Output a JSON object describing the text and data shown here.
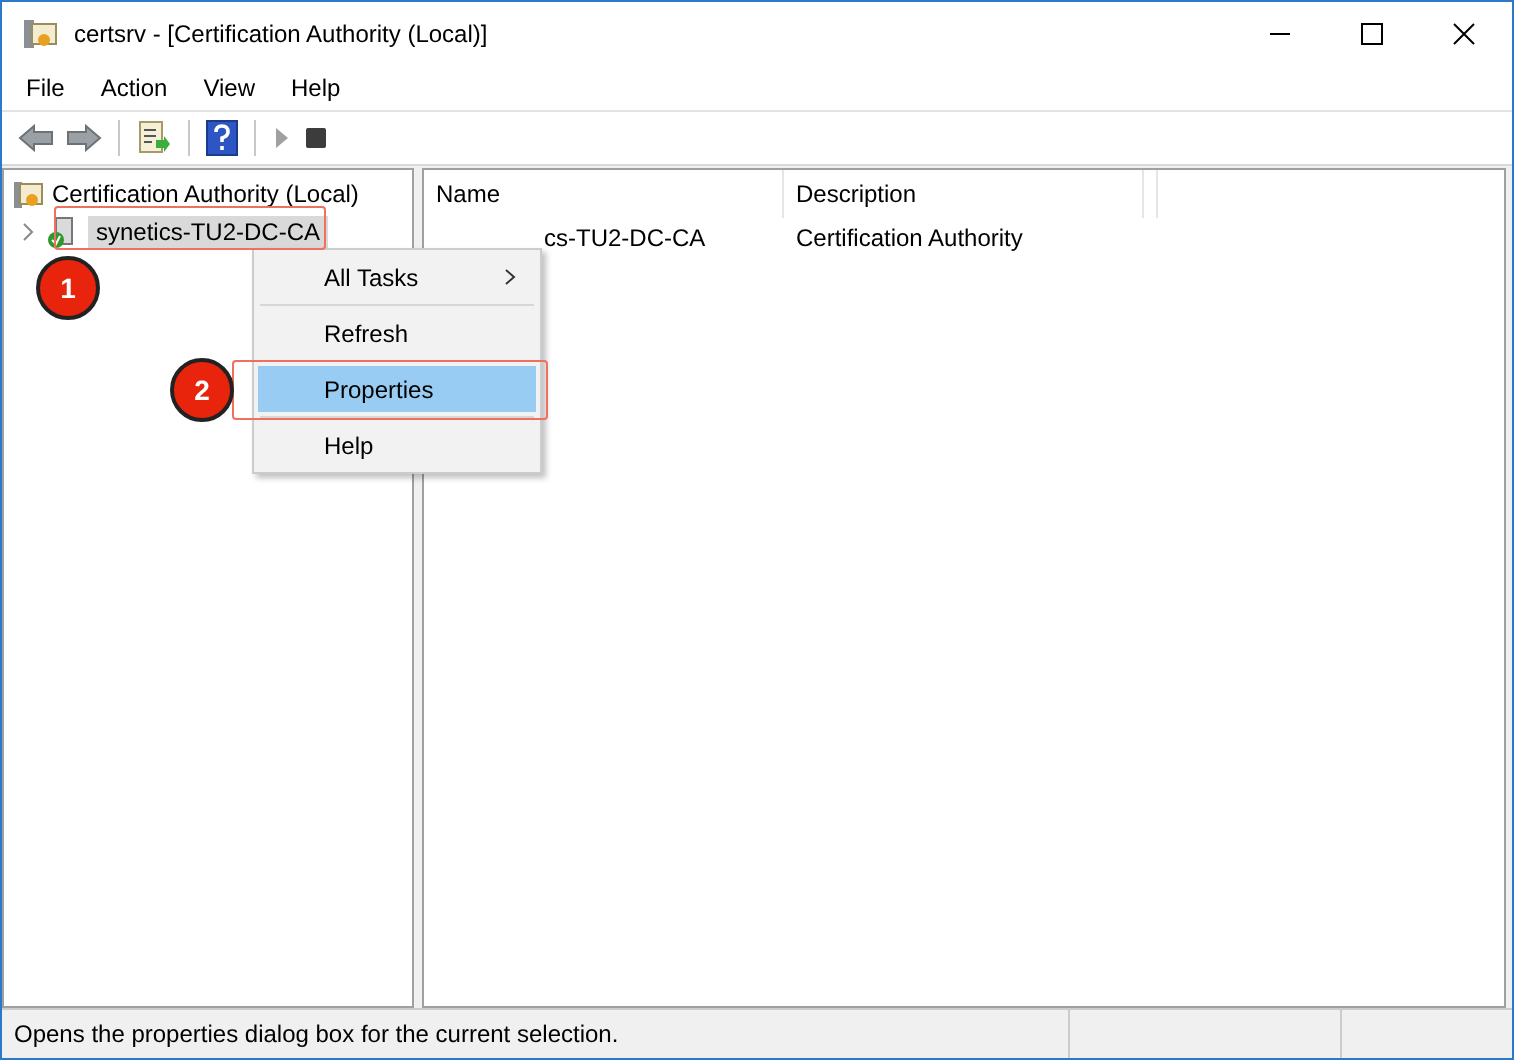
{
  "window": {
    "title": "certsrv - [Certification Authority (Local)]"
  },
  "menu_bar": [
    "File",
    "Action",
    "View",
    "Help"
  ],
  "tree": {
    "root": "Certification Authority (Local)",
    "children": [
      {
        "label": "synetics-TU2-DC-CA",
        "expanded": false,
        "selected": true
      }
    ]
  },
  "list": {
    "columns": [
      "Name",
      "Description"
    ],
    "rows": [
      {
        "name": "cs-TU2-DC-CA",
        "description": "Certification Authority"
      }
    ]
  },
  "context_menu": [
    {
      "label": "All Tasks",
      "submenu": true,
      "selected": false
    },
    {
      "label": "Refresh",
      "submenu": false,
      "selected": false
    },
    {
      "label": "Properties",
      "submenu": false,
      "selected": true
    },
    {
      "label": "Help",
      "submenu": false,
      "selected": false
    }
  ],
  "annotations": [
    {
      "label": "1"
    },
    {
      "label": "2"
    }
  ],
  "status_bar": "Opens the properties dialog box for the current selection."
}
